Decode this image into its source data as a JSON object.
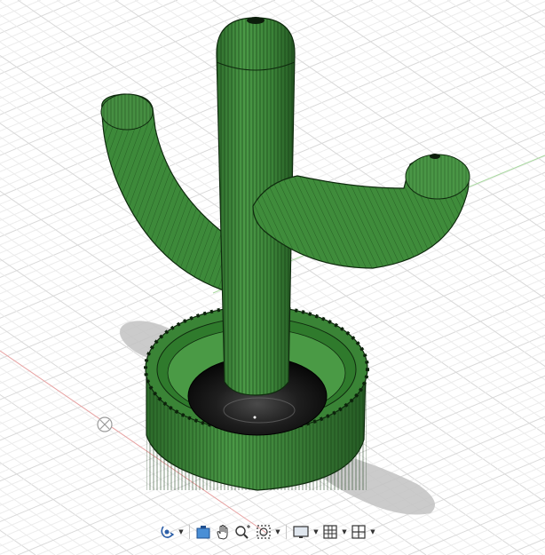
{
  "viewport": {
    "scene": "3d-model-cactus-ring-holder",
    "colors": {
      "background": "#ffffff",
      "grid_minor": "#ececec",
      "grid_major": "#d9d9d9",
      "axis_red": "#e7a2a2",
      "axis_green": "#a9d9a0",
      "cactus_green": "#3e8a3b",
      "cactus_dark": "#1f4f1e",
      "base_black": "#141414",
      "shadow": "#bdbdbd"
    }
  },
  "toolbar": {
    "items": [
      {
        "name": "orbit-icon",
        "has_menu": true
      },
      {
        "name": "look-at-icon",
        "has_menu": false
      },
      {
        "name": "pan-hand-icon",
        "has_menu": false
      },
      {
        "name": "zoom-icon",
        "has_menu": false
      },
      {
        "name": "fit-window-icon",
        "has_menu": true
      },
      {
        "name": "display-settings-icon",
        "has_menu": true
      },
      {
        "name": "grid-settings-icon",
        "has_menu": true
      },
      {
        "name": "viewports-icon",
        "has_menu": true
      }
    ]
  }
}
